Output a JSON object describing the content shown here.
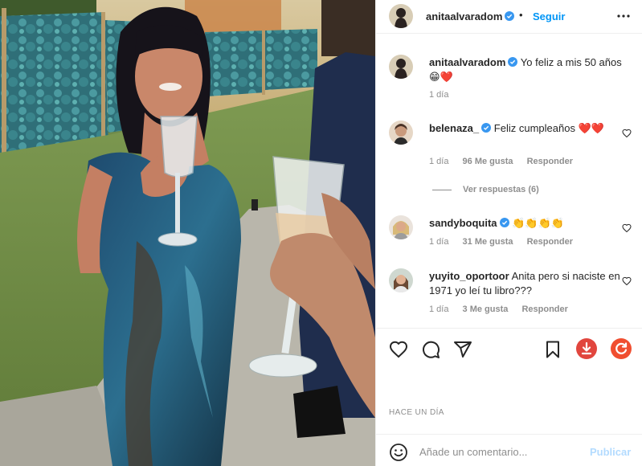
{
  "post": {
    "username": "anitaalvaradom",
    "separator": "•",
    "follow_label": "Seguir",
    "caption_user": "anitaalvaradom",
    "caption_text": "Yo feliz a mis 50 años 😁❤️",
    "caption_time": "1 día",
    "timestamp": "HACE UN DÍA"
  },
  "comments": [
    {
      "username": "belenaza_",
      "text": "Feliz cumpleaños ❤️❤️",
      "time": "1 día",
      "likes": "96 Me gusta",
      "reply": "Responder",
      "view_replies": "Ver respuestas (6)"
    },
    {
      "username": "sandyboquita",
      "text": "👏👏👏👏",
      "time": "1 día",
      "likes": "31 Me gusta",
      "reply": "Responder"
    },
    {
      "username": "yuyito_oportoor",
      "text": "Anita pero si naciste en 1971 yo leí tu libro???",
      "time": "1 día",
      "likes": "3 Me gusta",
      "reply": "Responder"
    }
  ],
  "composer": {
    "placeholder": "Añade un comentario...",
    "publish_label": "Publicar"
  },
  "icons": {
    "more": "more-options-icon",
    "like": "heart-icon",
    "comment": "comment-icon",
    "share": "share-icon",
    "save": "bookmark-icon",
    "download": "download-extension-icon",
    "refresh": "refresh-extension-icon",
    "emoji": "emoji-icon"
  },
  "colors": {
    "accent": "#0095f6",
    "publish_disabled": "#b3dbff",
    "verified": "#3897f0",
    "download_ext": "#e1463e",
    "refresh_ext": "#f04e30",
    "secondary_text": "#8e8e8e"
  }
}
